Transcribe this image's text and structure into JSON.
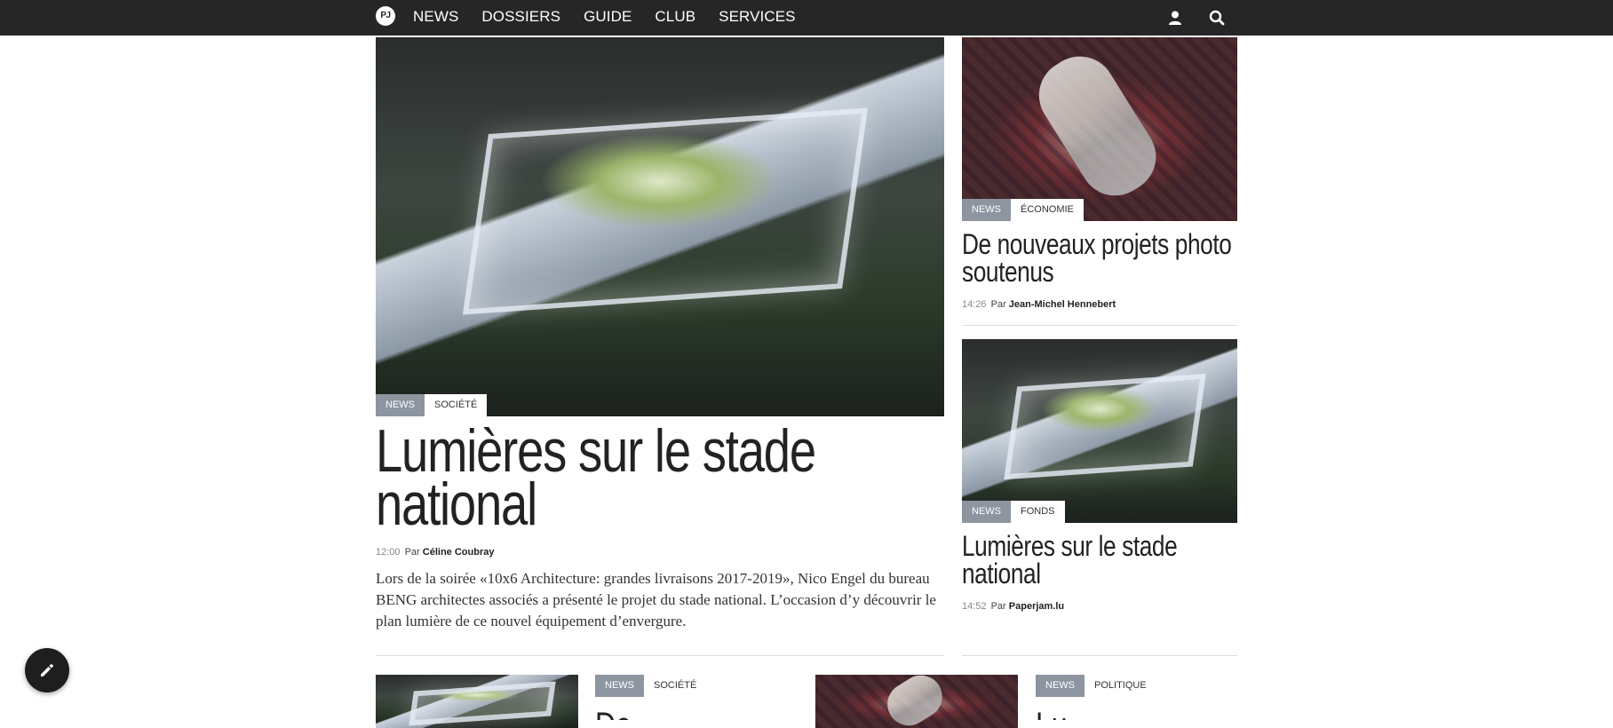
{
  "nav": {
    "logo": "PJ",
    "items": [
      "NEWS",
      "DOSSIERS",
      "GUIDE",
      "CLUB",
      "SERVICES"
    ],
    "icons": [
      "user-icon",
      "search-icon"
    ]
  },
  "featured": {
    "tags": [
      "NEWS",
      "SOCIÉTÉ"
    ],
    "title": "Lumières sur le stade national",
    "time": "12:00",
    "par": "Par",
    "author": "Céline Coubray",
    "excerpt": "Lors de la soirée «10x6 Architecture: grandes livraisons 2017-2019», Nico Engel du bureau BENG architectes associés a présenté le projet du stade national. L’occasion d’y découvrir le plan lumière de ce nouvel équipement d’envergure."
  },
  "side": [
    {
      "tags": [
        "NEWS",
        "ÉCONOMIE"
      ],
      "title": "De nouveaux projets photo soutenus",
      "time": "14:26",
      "par": "Par",
      "author": "Jean-Michel Hennebert"
    },
    {
      "tags": [
        "NEWS",
        "FONDS"
      ],
      "title": "Lumières sur le stade national",
      "time": "14:52",
      "par": "Par",
      "author": "Paperjam.lu"
    }
  ],
  "bottom": [
    {
      "tags": [
        "NEWS",
        "SOCIÉTÉ"
      ],
      "title_fragment": "De"
    },
    {
      "tags": [
        "NEWS",
        "POLITIQUE"
      ],
      "title_fragment": "Lu"
    }
  ],
  "colors": {
    "nav_bg": "#262626",
    "tag_bg": "#8d95a1",
    "edit_button_bg": "#1e1e1e"
  }
}
